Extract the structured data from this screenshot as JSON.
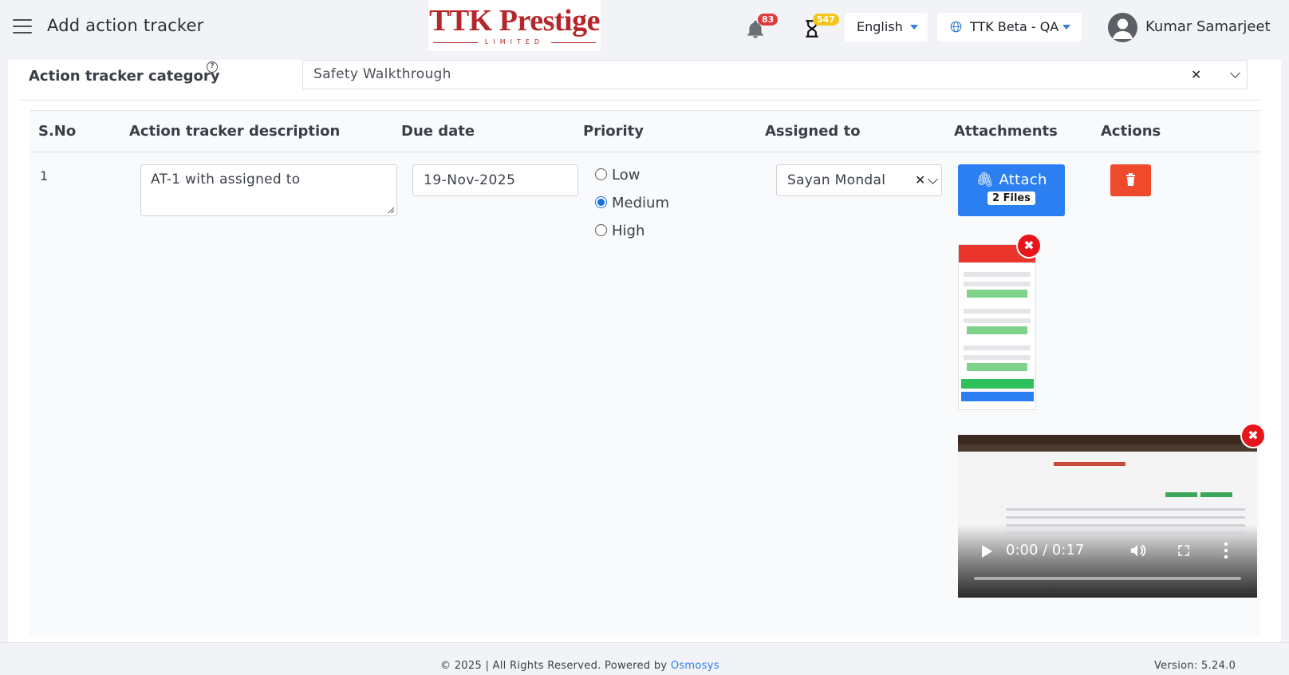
{
  "header": {
    "title": "Add action tracker",
    "logo": {
      "main": "TTK Prestige",
      "sub": "LIMITED"
    },
    "notifications_count": "83",
    "pending_count": "547",
    "language": "English",
    "environment": "TTK Beta - QA",
    "user_name": "Kumar Samarjeet"
  },
  "category": {
    "label": "Action tracker category",
    "value": "Safety Walkthrough"
  },
  "table": {
    "columns": [
      "S.No",
      "Action tracker description",
      "Due date",
      "Priority",
      "Assigned to",
      "Attachments",
      "Actions"
    ],
    "row": {
      "sno": "1",
      "description": "AT-1 with assigned to",
      "due_date": "19-Nov-2025",
      "priority_options": [
        "Low",
        "Medium",
        "High"
      ],
      "priority_selected": "Medium",
      "assigned_to": "Sayan Mondal",
      "attach_label": "Attach",
      "files_count": "2 Files",
      "video_time": "0:00 / 0:17"
    }
  },
  "footer": {
    "copyright": "© 2025 | All Rights Reserved. Powered by ",
    "powered_by": "Osmosys",
    "version": "Version: 5.24.0"
  },
  "colors": {
    "primary": "#2b7ff0",
    "danger": "#ef4a2c",
    "brand": "#b5262a"
  }
}
